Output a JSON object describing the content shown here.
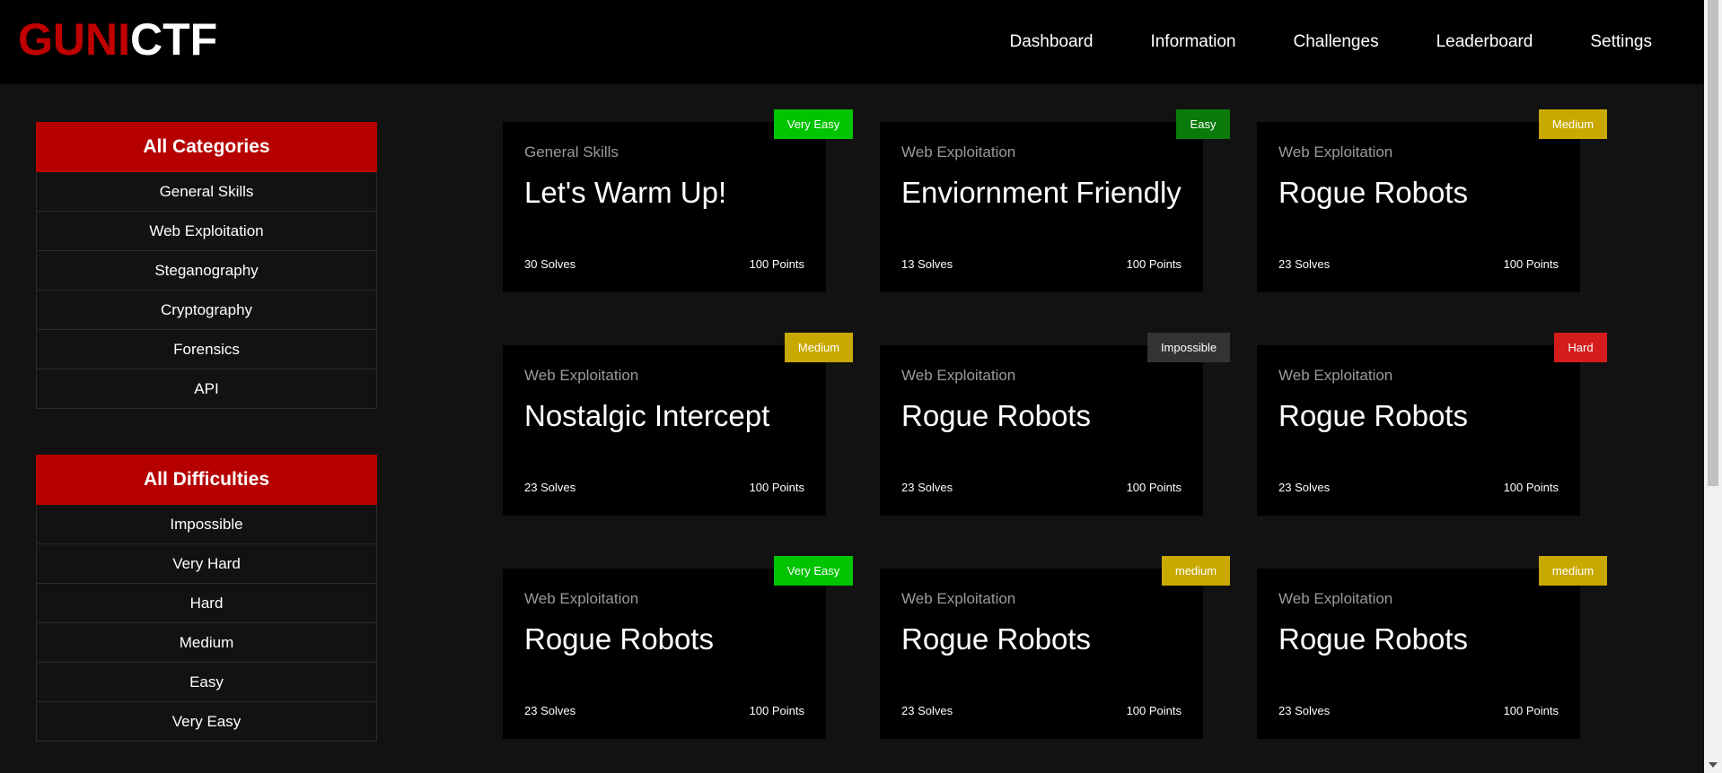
{
  "brand": {
    "part1": "GUNI",
    "part2": "CTF"
  },
  "nav": [
    "Dashboard",
    "Information",
    "Challenges",
    "Leaderboard",
    "Settings"
  ],
  "categories": {
    "heading": "All Categories",
    "items": [
      "General Skills",
      "Web Exploitation",
      "Steganography",
      "Cryptography",
      "Forensics",
      "API"
    ]
  },
  "difficulties": {
    "heading": "All Difficulties",
    "items": [
      "Impossible",
      "Very Hard",
      "Hard",
      "Medium",
      "Easy",
      "Very Easy"
    ]
  },
  "colors": {
    "brand_red": "#c00000",
    "panel_red": "#b60000",
    "very_easy": "#00c400",
    "easy": "#0a7a0a",
    "medium": "#c9a800",
    "impossible": "#333333",
    "hard": "#d41c1c"
  },
  "challenges": [
    {
      "category": "General Skills",
      "title": "Let's Warm Up!",
      "solves": "30 Solves",
      "points": "100 Points",
      "badge": "Very Easy",
      "badge_color": "#00c400"
    },
    {
      "category": "Web Exploitation",
      "title": "Enviornment Friendly",
      "solves": "13 Solves",
      "points": "100 Points",
      "badge": "Easy",
      "badge_color": "#0a7a0a"
    },
    {
      "category": "Web Exploitation",
      "title": "Rogue Robots",
      "solves": "23 Solves",
      "points": "100 Points",
      "badge": "Medium",
      "badge_color": "#c9a800"
    },
    {
      "category": "Web Exploitation",
      "title": "Nostalgic Intercept",
      "solves": "23 Solves",
      "points": "100 Points",
      "badge": "Medium",
      "badge_color": "#c9a800"
    },
    {
      "category": "Web Exploitation",
      "title": "Rogue Robots",
      "solves": "23 Solves",
      "points": "100 Points",
      "badge": "Impossible",
      "badge_color": "#333333"
    },
    {
      "category": "Web Exploitation",
      "title": "Rogue Robots",
      "solves": "23 Solves",
      "points": "100 Points",
      "badge": "Hard",
      "badge_color": "#d41c1c"
    },
    {
      "category": "Web Exploitation",
      "title": "Rogue Robots",
      "solves": "23 Solves",
      "points": "100 Points",
      "badge": "Very Easy",
      "badge_color": "#00c400"
    },
    {
      "category": "Web Exploitation",
      "title": "Rogue Robots",
      "solves": "23 Solves",
      "points": "100 Points",
      "badge": "medium",
      "badge_color": "#c9a800"
    },
    {
      "category": "Web Exploitation",
      "title": "Rogue Robots",
      "solves": "23 Solves",
      "points": "100 Points",
      "badge": "medium",
      "badge_color": "#c9a800"
    }
  ]
}
